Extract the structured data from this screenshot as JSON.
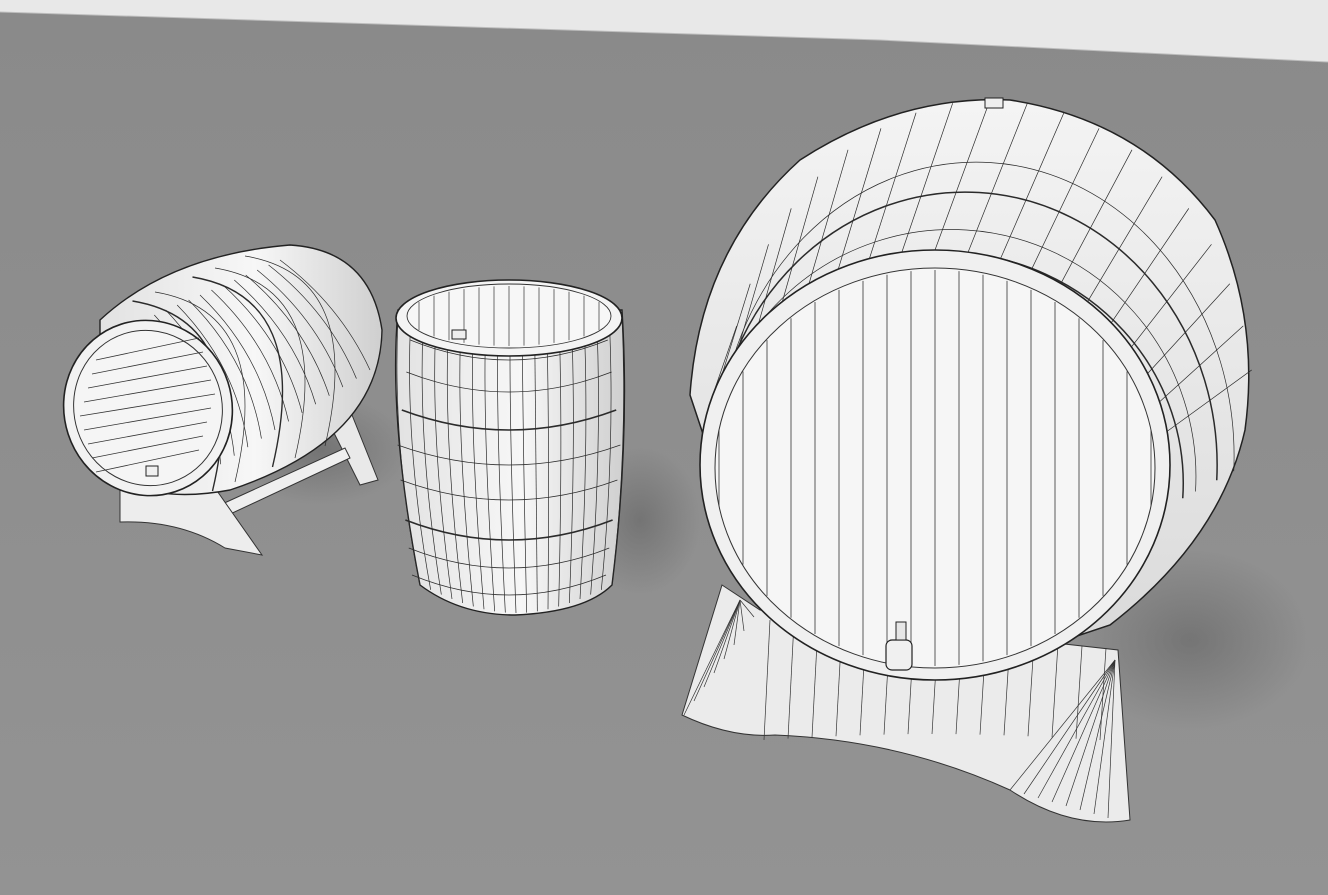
{
  "scene": {
    "subject": "wireframe-render-of-three-wooden-barrels",
    "objects": [
      "barrel-on-stand",
      "upright-barrel",
      "large-barrel-on-stand"
    ],
    "colors": {
      "floor": "#8f8f8f",
      "wall": "#e9e9e9",
      "surface": "#f3f3f3",
      "shade": "#d6d6d6",
      "shadow": "#5e5e5e",
      "wire": "#2b2b2b"
    }
  }
}
